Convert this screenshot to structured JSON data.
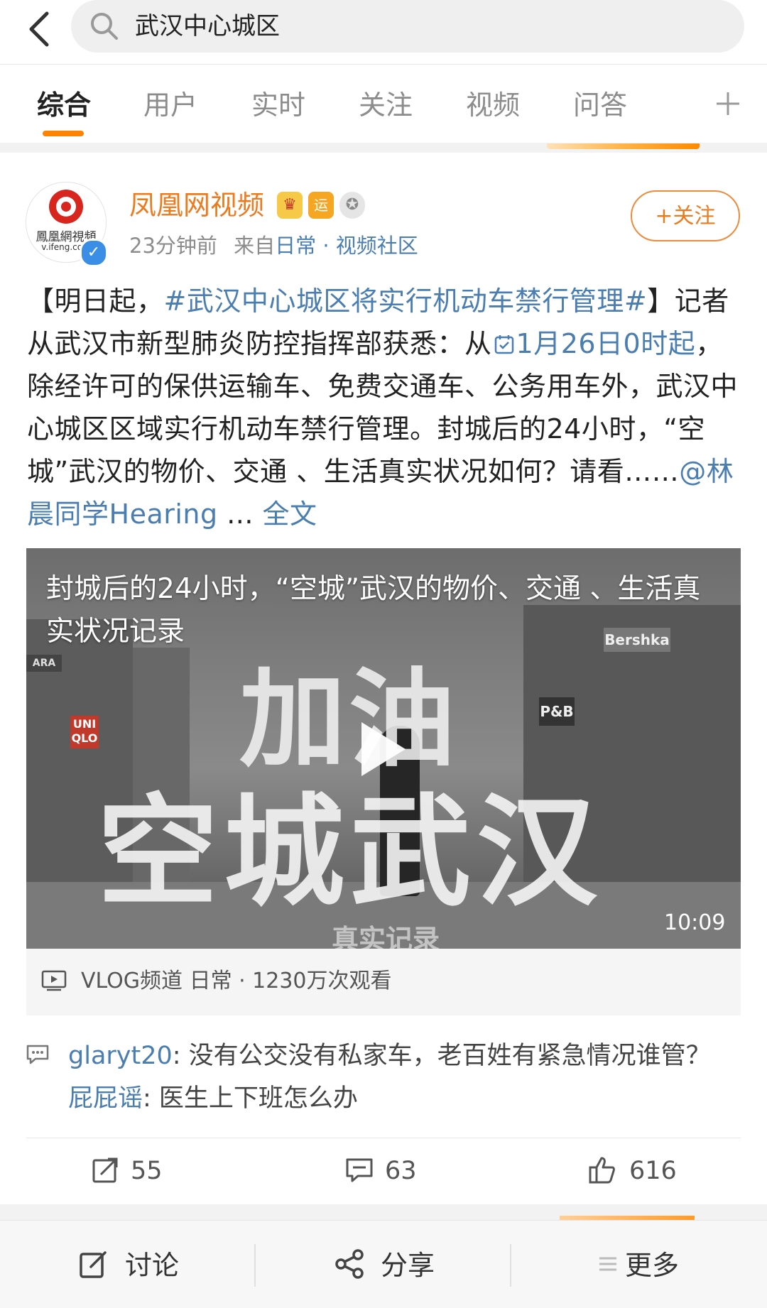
{
  "search": {
    "query": "武汉中心城区"
  },
  "tabs": [
    {
      "label": "综合",
      "active": true
    },
    {
      "label": "用户"
    },
    {
      "label": "实时"
    },
    {
      "label": "关注"
    },
    {
      "label": "视频"
    },
    {
      "label": "问答"
    }
  ],
  "post": {
    "avatar": {
      "name_cn": "鳳凰網視頻",
      "url": "v.ifeng.com"
    },
    "username": "凤凰网视频",
    "badges": [
      "crown-vip-icon",
      "yun-badge-icon",
      "medal-badge-icon"
    ],
    "meta": {
      "time": "23分钟前",
      "from_label": "来自",
      "source": "日常 · 视频社区"
    },
    "follow_label": "+关注",
    "text": {
      "open": "【明日起，",
      "hashtag": "#武汉中心城区将实行机动车禁行管理#",
      "close": "】",
      "p1": "记者从武汉市新型肺炎防控指挥部获悉：从",
      "date_link": "1月26日0时起",
      "p2": "，除经许可的保供运输车、免费交通车、公务用车外，武汉中心城区区域实行机动车禁行管理。封城后的24小时，“空城”武汉的物价、交通 、生活真实状况如何？请看……",
      "mention": "@林晨同学Hearing",
      "more_prefix": " ... ",
      "more_link": "全文"
    },
    "video": {
      "title": "封城后的24小时，“空城”武汉的物价、交通 、生活真实状况记录",
      "overlay_top": "加油",
      "overlay_bottom": "空城武汉",
      "overlay_caption": "真实记录",
      "duration": "10:09",
      "signs": [
        "UNI QLO",
        "Bershka",
        "P&B",
        "ARA"
      ]
    },
    "video_info": "VLOG频道 日常 · 1230万次观看",
    "comments": [
      {
        "user": "glaryt20",
        "text": ": 没有公交没有私家车，老百姓有紧急情况谁管？"
      },
      {
        "user": "屁屁谣",
        "text": ": 医生上下班怎么办"
      }
    ],
    "actions": {
      "reposts": "55",
      "comments": "63",
      "likes": "616"
    }
  },
  "bottom_bar": {
    "discuss": "讨论",
    "share": "分享",
    "more": "更多"
  },
  "colors": {
    "accent": "#ff8200",
    "link": "#4a7db0",
    "username": "#ee7a1e"
  }
}
